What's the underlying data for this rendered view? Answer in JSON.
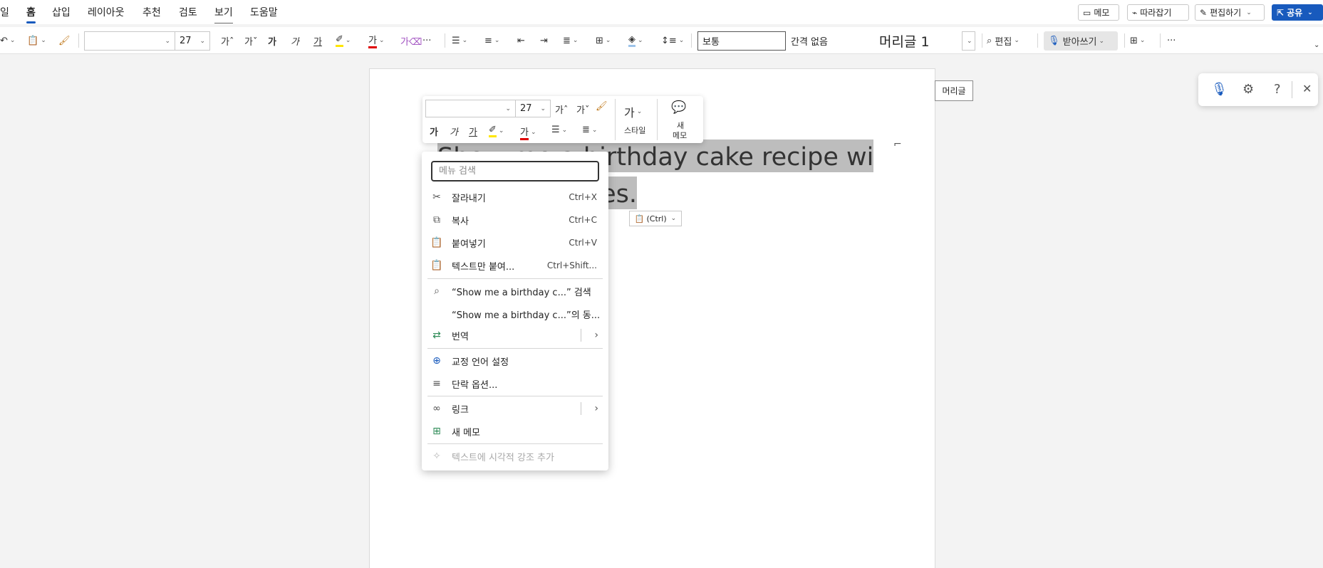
{
  "menubar": {
    "tabs": [
      "일",
      "홈",
      "삽입",
      "레이아웃",
      "추천",
      "검토",
      "보기",
      "도움말"
    ],
    "memo": "메모",
    "catchup": "따라잡기",
    "editing": "편집하기",
    "share": "공유"
  },
  "ribbon": {
    "font_size": "27",
    "style_normal": "보통",
    "style_nospace": "간격 없음",
    "style_heading1": "머리글 1",
    "find": "편집",
    "dictate": "받아쓰기"
  },
  "mini_toolbar": {
    "font_size": "27",
    "styles": "스타일",
    "new_memo_line1": "새",
    "new_memo_line2": "메모"
  },
  "document": {
    "line1": "Show me a birthday cake recipe with",
    "line2_tail": "es.",
    "paste_chip": "(Ctrl)",
    "style_label": "머리글"
  },
  "context_menu": {
    "search_placeholder": "메뉴 검색",
    "cut": "잘라내기",
    "cut_sc": "Ctrl+X",
    "copy": "복사",
    "copy_sc": "Ctrl+C",
    "paste": "붙여넣기",
    "paste_sc": "Ctrl+V",
    "paste_text": "텍스트만 붙여...",
    "paste_text_sc": "Ctrl+Shift...",
    "search_item": "“Show me a birthday c...” 검색",
    "synonyms": "“Show me a birthday c...”의 동...",
    "translate": "번역",
    "proofing": "교정 언어 설정",
    "paragraph": "단락 옵션...",
    "link": "링크",
    "new_memo": "새 메모",
    "visual_emphasis": "텍스트에 시각적 강조 추가"
  }
}
